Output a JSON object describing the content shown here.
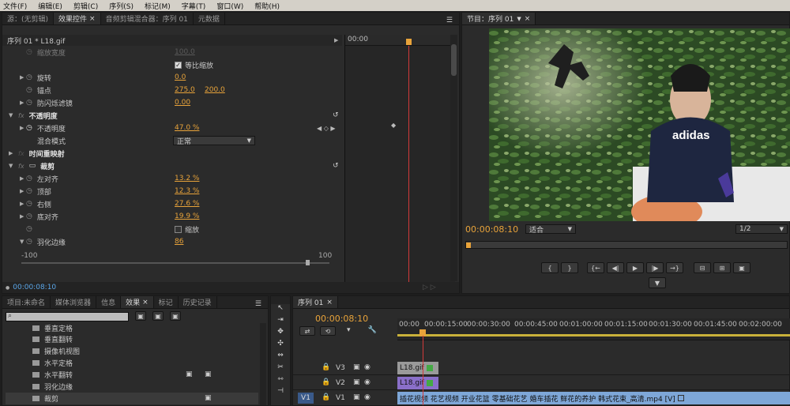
{
  "menu": [
    "文件(F)",
    "编辑(E)",
    "剪辑(C)",
    "序列(S)",
    "标记(M)",
    "字幕(T)",
    "窗口(W)",
    "帮助(H)"
  ],
  "source_panel": {
    "tabs": [
      "源：(无剪辑)",
      "效果控件",
      "音频剪辑混合器：序列 01",
      "元数据"
    ],
    "header": "序列 01 * L18.gif",
    "ruler_time": "00:00",
    "rows": {
      "scale_width": {
        "label": "缩放宽度",
        "value": "100.0"
      },
      "uniform": {
        "label": "等比缩放"
      },
      "rotation": {
        "label": "旋转",
        "value": "0.0"
      },
      "anchor": {
        "label": "锚点",
        "x": "275.0",
        "y": "200.0"
      },
      "flicker": {
        "label": "防闪烁滤镜",
        "value": "0.00"
      },
      "opacity_section": {
        "label": "不透明度"
      },
      "opacity": {
        "label": "不透明度",
        "value": "47.0 %"
      },
      "blend": {
        "label": "混合模式",
        "value": "正常"
      },
      "time_remap": {
        "label": "时间重映射"
      },
      "crop_section": {
        "label": "裁剪"
      },
      "left": {
        "label": "左对齐",
        "value": "13.2 %"
      },
      "top": {
        "label": "顶部",
        "value": "12.3 %"
      },
      "right": {
        "label": "右侧",
        "value": "27.6 %"
      },
      "bottom": {
        "label": "底对齐",
        "value": "19.9 %"
      },
      "zoom": {
        "label": "缩放"
      },
      "feather": {
        "label": "羽化边缘",
        "value": "86"
      },
      "slider_min": "-100",
      "slider_max": "100"
    },
    "timecode": "00:00:08:10"
  },
  "program": {
    "tab": "节目：序列 01",
    "timecode": "00:00:08:10",
    "fit": "适合",
    "resolution": "1/2",
    "shirt_text": "adidas"
  },
  "project_panel": {
    "tabs": [
      "项目:未命名",
      "媒体浏览器",
      "信息",
      "效果",
      "标记",
      "历史记录"
    ],
    "items": [
      "垂直定格",
      "垂直翻转",
      "摄像机视图",
      "水平定格",
      "水平翻转",
      "羽化边缘",
      "裁剪"
    ]
  },
  "timeline": {
    "tab": "序列 01",
    "timecode": "00:00:08:10",
    "ruler": [
      "00:00",
      "00:00:15:00",
      "00:00:30:00",
      "00:00:45:00",
      "00:01:00:00",
      "00:01:15:00",
      "00:01:30:00",
      "00:01:45:00",
      "00:02:00:00"
    ],
    "tracks": [
      {
        "name": "V3",
        "clip": "L18.gif"
      },
      {
        "name": "V2",
        "clip": "L18.gif"
      },
      {
        "name": "V1",
        "src": "V1",
        "clip": "插花视频 花艺视频 开业花篮 零基础花艺 婚车插花 鲜花的养护 韩式花束_高清.mp4 [V]"
      }
    ]
  },
  "colors": {
    "accent": "#e8a33a",
    "playhead": "#d23a3a",
    "clip_v3": "#9a9a9a",
    "clip_v2": "#8a6fc9",
    "clip_v1": "#7ea7d8"
  }
}
